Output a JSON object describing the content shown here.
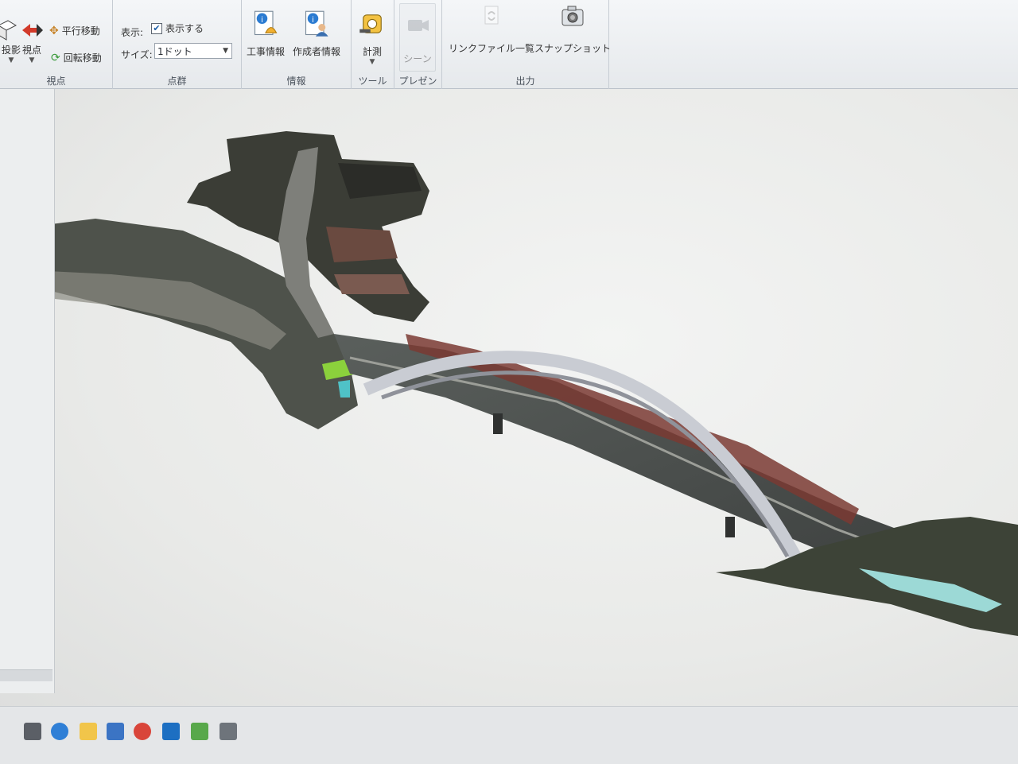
{
  "ribbon": {
    "groups": {
      "viewpoint": {
        "label": "視点",
        "projection_label": "投影",
        "viewpoint_label": "視点",
        "pan_label": "平行移動",
        "rotate_label": "回転移動"
      },
      "pointcloud": {
        "label": "点群",
        "display_label": "表示:",
        "show_label": "表示する",
        "show_checked": true,
        "size_label": "サイズ:",
        "size_value": "1ドット"
      },
      "info": {
        "label": "情報",
        "construction_info": "工事情報",
        "author_info": "作成者情報"
      },
      "tools": {
        "label": "ツール",
        "measure": "計測"
      },
      "presentation": {
        "label": "プレゼン",
        "scene": "シーン"
      },
      "output": {
        "label": "出力",
        "link_file_list": "リンクファイル一覧",
        "snapshot": "スナップショット"
      }
    }
  },
  "colors": {
    "ribbon_bg": "#eef0f2",
    "viewport_bg": "#efefef",
    "bridge_steel": "#c9ccd3",
    "truss_red": "#7a3a32",
    "vegetation": "#3c4a33",
    "accent_green": "#8bd13c"
  },
  "icons": [
    "projection-cube-icon",
    "viewpoint-arrow-icon",
    "pan-icon",
    "rotate-icon",
    "construction-info-icon",
    "author-info-icon",
    "measure-tape-icon",
    "scene-camera-icon",
    "link-file-icon",
    "snapshot-camera-icon"
  ]
}
